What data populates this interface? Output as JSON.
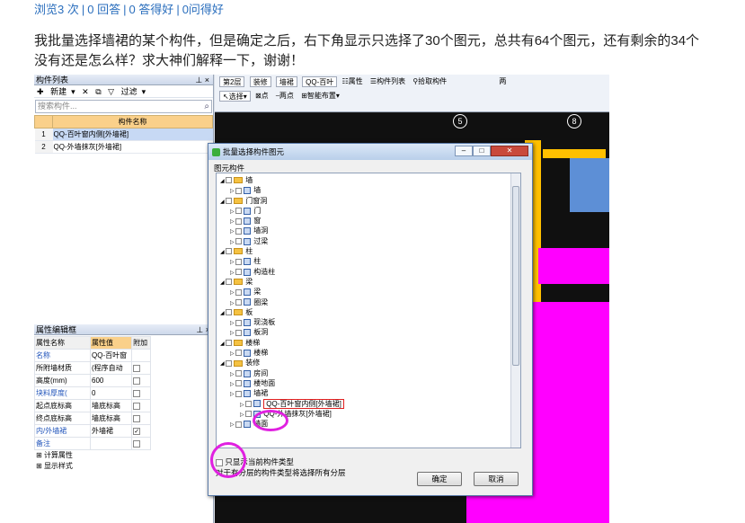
{
  "stats": {
    "views": "浏览3 次",
    "answers": "0 回答",
    "good_answers": "0 答得好",
    "got_good": "0问得好"
  },
  "question": {
    "line1": "我批量选择墙裙的某个构件，但是确定之后，右下角显示只选择了30个图元，总共有64个图元，还有剩余的34个",
    "line2": "没有还是怎么样？求大神们解释一下，谢谢！"
  },
  "left_panel": {
    "title": "构件列表",
    "new_label": "新建",
    "filter_label": "过滤",
    "search_placeholder": "搜索构件...",
    "col_header": "构件名称",
    "rows": [
      {
        "n": "1",
        "name": "QQ-百叶窗内侧[外墙裙]"
      },
      {
        "n": "2",
        "name": "QQ-外墙抹灰[外墙裙]"
      }
    ]
  },
  "props": {
    "title": "属性编辑框",
    "headers": {
      "name": "属性名称",
      "value": "属性值",
      "extra": "附加"
    },
    "rows": [
      {
        "k": "名称",
        "v": "QQ-百叶窗"
      },
      {
        "k": "所附墙材质",
        "v": "(程序自动"
      },
      {
        "k": "高度(mm)",
        "v": "600"
      },
      {
        "k": "块料厚度(",
        "v": "0"
      },
      {
        "k": "起点底标高",
        "v": "墙底标高"
      },
      {
        "k": "终点底标高",
        "v": "墙底标高"
      },
      {
        "k": "内/外墙裙",
        "v": "外墙裙"
      },
      {
        "k": "备注",
        "v": ""
      }
    ],
    "calc": "计算属性",
    "display": "显示样式"
  },
  "topbar": {
    "floor": "第2层",
    "category": "装修",
    "type": "墙裙",
    "component": "QQ-百叶",
    "attr_btn": "属性",
    "list_btn": "构件列表",
    "pick_btn": "拾取构件",
    "select_btn": "选择",
    "point_btn": "点",
    "twopoint_btn": "两点",
    "smart_btn": "智能布置",
    "extra": "两"
  },
  "scene": {
    "axis_5": "5",
    "axis_8": "8"
  },
  "dialog": {
    "title": "批量选择构件图元",
    "group": "图元构件",
    "tree": [
      {
        "level": 0,
        "label": "墙",
        "folder": true
      },
      {
        "level": 1,
        "label": "墙"
      },
      {
        "level": 0,
        "label": "门窗洞",
        "folder": true
      },
      {
        "level": 1,
        "label": "门"
      },
      {
        "level": 1,
        "label": "窗"
      },
      {
        "level": 1,
        "label": "墙洞"
      },
      {
        "level": 1,
        "label": "过梁"
      },
      {
        "level": 0,
        "label": "柱",
        "folder": true
      },
      {
        "level": 1,
        "label": "柱"
      },
      {
        "level": 1,
        "label": "构造柱"
      },
      {
        "level": 0,
        "label": "梁",
        "folder": true
      },
      {
        "level": 1,
        "label": "梁"
      },
      {
        "level": 1,
        "label": "圈梁"
      },
      {
        "level": 0,
        "label": "板",
        "folder": true
      },
      {
        "level": 1,
        "label": "现浇板"
      },
      {
        "level": 1,
        "label": "板洞"
      },
      {
        "level": 0,
        "label": "楼梯",
        "folder": true
      },
      {
        "level": 1,
        "label": "楼梯"
      },
      {
        "level": 0,
        "label": "装修",
        "folder": true
      },
      {
        "level": 1,
        "label": "房间"
      },
      {
        "level": 1,
        "label": "楼地面"
      },
      {
        "level": 1,
        "label": "墙裙"
      },
      {
        "level": 2,
        "label": "QQ-百叶窗内侧[外墙裙]",
        "highlight": true
      },
      {
        "level": 2,
        "label": "QQ-外墙抹灰[外墙裙]"
      },
      {
        "level": 1,
        "label": "墙面"
      }
    ],
    "only_current": "只显示当前构件类型",
    "note": "对于有分层的构件类型将选择所有分层",
    "ok": "确定",
    "cancel": "取消"
  }
}
